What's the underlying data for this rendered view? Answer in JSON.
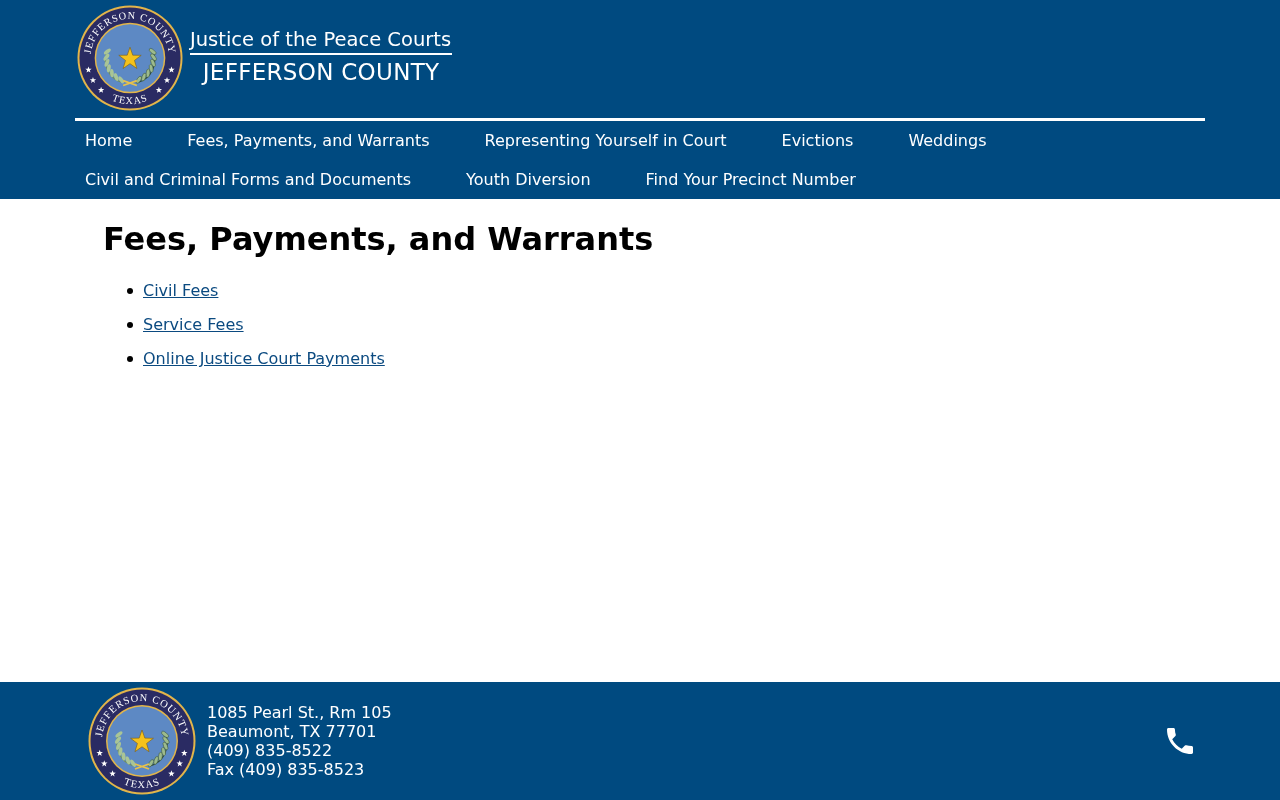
{
  "header": {
    "seal": {
      "top_text": "JEFFERSON COUNTY",
      "bottom_text": "TEXAS"
    },
    "title": "Justice of the Peace Courts",
    "subtitle": "JEFFERSON COUNTY"
  },
  "nav": {
    "items": [
      "Home",
      "Fees, Payments, and Warrants",
      "Representing Yourself in Court",
      "Evictions",
      "Weddings",
      "Civil and Criminal Forms and Documents",
      "Youth Diversion",
      "Find Your Precinct Number"
    ]
  },
  "main": {
    "heading": "Fees, Payments, and Warrants",
    "links": [
      "Civil Fees",
      "Service Fees",
      "Online Justice Court Payments"
    ]
  },
  "footer": {
    "seal": {
      "top_text": "JEFFERSON COUNTY",
      "bottom_text": "TEXAS"
    },
    "address_lines": [
      "1085 Pearl St., Rm 105",
      "Beaumont, TX 77701",
      "(409) 835-8522",
      "Fax (409) 835-8523"
    ]
  }
}
